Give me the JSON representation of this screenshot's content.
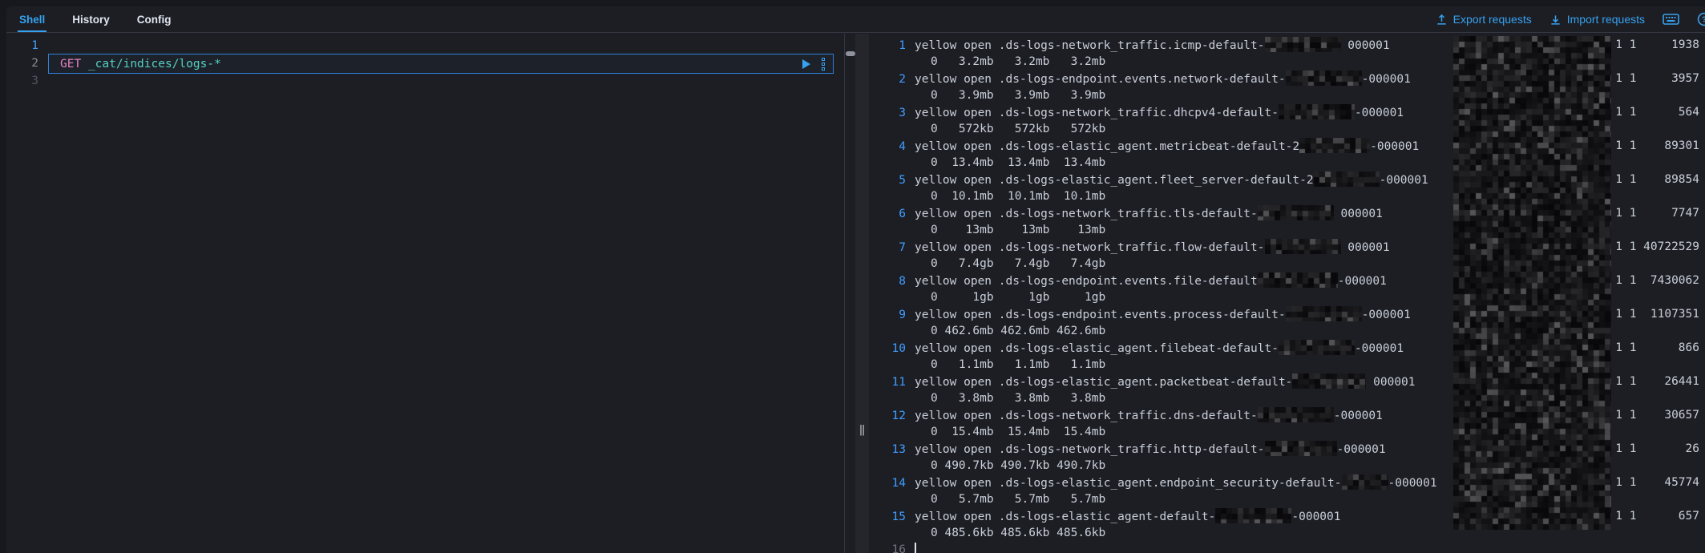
{
  "header": {
    "tabs": [
      {
        "label": "Shell",
        "active": true
      },
      {
        "label": "History",
        "active": false
      },
      {
        "label": "Config",
        "active": false
      }
    ],
    "actions": {
      "export_label": "Export requests",
      "import_label": "Import requests"
    }
  },
  "colors": {
    "accent_blue": "#36a2ef",
    "method_pink": "#e881c3",
    "url_teal": "#56d0c4",
    "line_number_blue": "#3f9dff",
    "output_text": "#c9cfd9",
    "panel_bg": "#1d1e24",
    "border": "#343741"
  },
  "editor": {
    "lines": [
      {
        "number": "1"
      },
      {
        "number": "2",
        "method": "GET",
        "url": "_cat/indices/logs-*",
        "selected": true
      },
      {
        "number": "3"
      }
    ]
  },
  "output": {
    "rows": [
      {
        "n": "1",
        "health": "yellow",
        "status": "open",
        "index_prefix": ".ds-logs-network_traffic.icmp-default-",
        "suffix": " 000001",
        "sizes": "0   3.2mb   3.2mb   3.2mb",
        "shards": "1 1",
        "docs": "1938",
        "patch_w": 95
      },
      {
        "n": "2",
        "health": "yellow",
        "status": "open",
        "index_prefix": ".ds-logs-endpoint.events.network-default-",
        "suffix": "-000001",
        "sizes": "0   3.9mb   3.9mb   3.9mb",
        "shards": "1 1",
        "docs": "3957",
        "patch_w": 95
      },
      {
        "n": "3",
        "health": "yellow",
        "status": "open",
        "index_prefix": ".ds-logs-network_traffic.dhcpv4-default-",
        "suffix": "-000001",
        "sizes": "0   572kb   572kb   572kb",
        "shards": "1 1",
        "docs": "564",
        "patch_w": 95
      },
      {
        "n": "4",
        "health": "yellow",
        "status": "open",
        "index_prefix": ".ds-logs-elastic_agent.metricbeat-default-2",
        "suffix": "-000001",
        "sizes": "0  13.4mb  13.4mb  13.4mb",
        "shards": "1 1",
        "docs": "89301",
        "patch_w": 88
      },
      {
        "n": "5",
        "health": "yellow",
        "status": "open",
        "index_prefix": ".ds-logs-elastic_agent.fleet_server-default-2",
        "suffix": "-000001",
        "sizes": "0  10.1mb  10.1mb  10.1mb",
        "shards": "1 1",
        "docs": "89854",
        "patch_w": 82
      },
      {
        "n": "6",
        "health": "yellow",
        "status": "open",
        "index_prefix": ".ds-logs-network_traffic.tls-default-",
        "suffix": " 000001",
        "sizes": "0    13mb    13mb    13mb",
        "shards": "1 1",
        "docs": "7747",
        "patch_w": 95
      },
      {
        "n": "7",
        "health": "yellow",
        "status": "open",
        "index_prefix": ".ds-logs-network_traffic.flow-default-",
        "suffix": " 000001",
        "sizes": "0   7.4gb   7.4gb   7.4gb",
        "shards": "1 1",
        "docs": "40722529",
        "patch_w": 95
      },
      {
        "n": "8",
        "health": "yellow",
        "status": "open",
        "index_prefix": ".ds-logs-endpoint.events.file-default",
        "suffix": "-000001",
        "sizes": "0     1gb     1gb     1gb",
        "shards": "1 1",
        "docs": "7430062",
        "patch_w": 100
      },
      {
        "n": "9",
        "health": "yellow",
        "status": "open",
        "index_prefix": ".ds-logs-endpoint.events.process-default-",
        "suffix": "-000001",
        "sizes": "0 462.6mb 462.6mb 462.6mb",
        "shards": "1 1",
        "docs": "1107351",
        "patch_w": 95
      },
      {
        "n": "10",
        "health": "yellow",
        "status": "open",
        "index_prefix": ".ds-logs-elastic_agent.filebeat-default-",
        "suffix": "-000001",
        "sizes": "0   1.1mb   1.1mb   1.1mb",
        "shards": "1 1",
        "docs": "866",
        "patch_w": 95
      },
      {
        "n": "11",
        "health": "yellow",
        "status": "open",
        "index_prefix": ".ds-logs-elastic_agent.packetbeat-default-",
        "suffix": " 000001",
        "sizes": "0   3.8mb   3.8mb   3.8mb",
        "shards": "1 1",
        "docs": "26441",
        "patch_w": 92
      },
      {
        "n": "12",
        "health": "yellow",
        "status": "open",
        "index_prefix": ".ds-logs-network_traffic.dns-default-",
        "suffix": "-000001",
        "sizes": "0  15.4mb  15.4mb  15.4mb",
        "shards": "1 1",
        "docs": "30657",
        "patch_w": 95
      },
      {
        "n": "13",
        "health": "yellow",
        "status": "open",
        "index_prefix": ".ds-logs-network_traffic.http-default-",
        "suffix": "-000001",
        "sizes": "0 490.7kb 490.7kb 490.7kb",
        "shards": "1 1",
        "docs": "26",
        "patch_w": 90
      },
      {
        "n": "14",
        "health": "yellow",
        "status": "open",
        "index_prefix": ".ds-logs-elastic_agent.endpoint_security-default-",
        "suffix": "-000001",
        "sizes": "0   5.7mb   5.7mb   5.7mb",
        "shards": "1 1",
        "docs": "45774",
        "patch_w": 58
      },
      {
        "n": "15",
        "health": "yellow",
        "status": "open",
        "index_prefix": ".ds-logs-elastic_agent-default-",
        "suffix": "-000001",
        "sizes": "0 485.6kb 485.6kb 485.6kb",
        "shards": "1 1",
        "docs": "657",
        "patch_w": 95
      }
    ],
    "trailing_line_number": "16"
  }
}
